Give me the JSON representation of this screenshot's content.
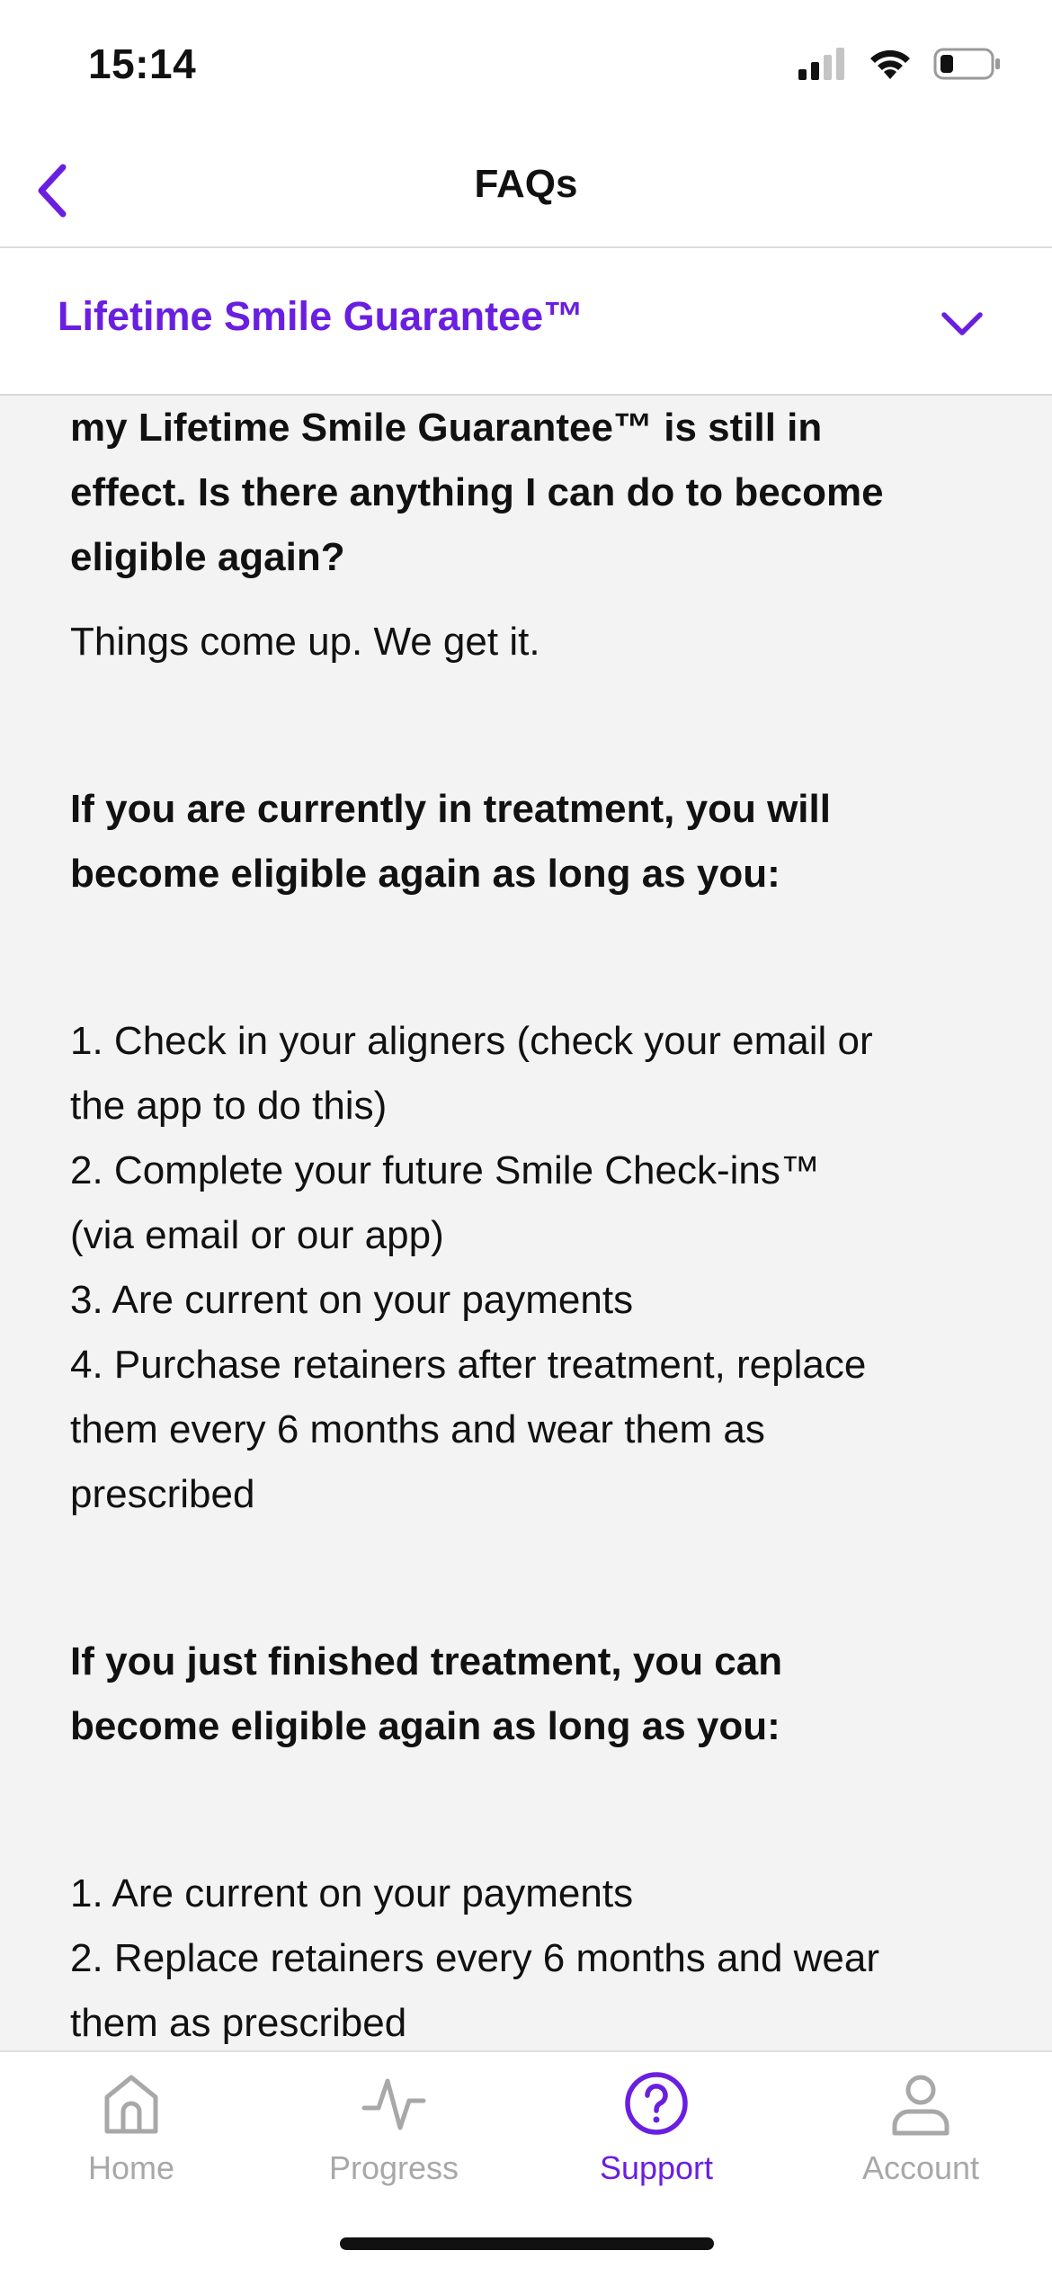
{
  "status_bar": {
    "time": "15:14",
    "signal_icon": "cellular-signal-icon",
    "wifi_icon": "wifi-icon",
    "battery_icon": "battery-low-icon"
  },
  "header": {
    "title": "FAQs",
    "back_icon": "chevron-left-icon"
  },
  "category": {
    "label": "Lifetime Smile Guarantee™",
    "icon": "chevron-down-icon"
  },
  "content": {
    "question_lines": [
      "my Lifetime Smile Guarantee™ is still in",
      "effect. Is there anything I can do to become",
      "eligible again?"
    ],
    "intro": "Things come up. We get it.",
    "in_treatment_heading_lines": [
      "If you are currently in treatment, you will",
      "become eligible again as long as you:"
    ],
    "in_treatment_items": [
      [
        "1. Check in your aligners (check your email or",
        "the app to do this)"
      ],
      [
        "2. Complete your future Smile Check-ins™",
        "(via email or our app)"
      ],
      [
        "3. Are current on your payments"
      ],
      [
        "4. Purchase retainers after treatment, replace",
        "them every 6 months and wear them as",
        "prescribed"
      ]
    ],
    "finished_heading_lines": [
      "If you just finished treatment, you can",
      "become eligible again as long as you:"
    ],
    "finished_items": [
      [
        "1. Are current on your payments"
      ],
      [
        "2. Replace retainers every 6 months and wear",
        "them as prescribed"
      ]
    ]
  },
  "tabs": [
    {
      "label": "Home",
      "icon": "home-icon",
      "active": false
    },
    {
      "label": "Progress",
      "icon": "pulse-icon",
      "active": false
    },
    {
      "label": "Support",
      "icon": "help-circle-icon",
      "active": true
    },
    {
      "label": "Account",
      "icon": "person-icon",
      "active": false
    }
  ],
  "colors": {
    "accent": "#6a1fe0",
    "inactive_tab": "#a8a8a8",
    "content_bg": "#f3f3f3",
    "text": "#111111"
  }
}
